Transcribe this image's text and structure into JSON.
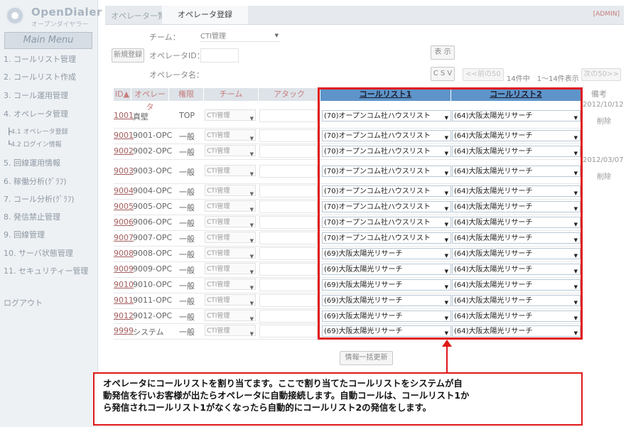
{
  "logo": {
    "name_en": "OpenDialer",
    "name_ja": "オープンダイヤラー"
  },
  "sidebar": {
    "main_menu": "Main Menu",
    "items": [
      "1. コールリスト管理",
      "2. コールリスト作成",
      "3. コール運用管理",
      "4. オペレータ管理",
      "┣4.1 オペレータ登録",
      "┗4.2 ログイン情報",
      "5. 回線運用情報",
      "6. 稼働分析(ｸﾞﾗﾌ)",
      "7. コール分析(ｸﾞﾗﾌ)",
      "8. 発信禁止管理",
      "9. 回線管理",
      "10. サーバ状態管理",
      "11. セキュリティー管理",
      "ログアウト"
    ]
  },
  "header": {
    "tab_list": "オペレータ一覧",
    "tab_register": "オペレータ登録",
    "admin": "[ADMIN]"
  },
  "form": {
    "team_label": "チーム：",
    "team_value": "CTI管理",
    "new_register_btn": "新規登録",
    "operator_id_label": "オペレータID：",
    "operator_name_label": "オペレータ名：",
    "show_btn": "表 示",
    "csv_btn": "C S V",
    "prev_btn": "<<前の50",
    "count": "14件中　1～14件表示",
    "next_btn": "次の50>>"
  },
  "table": {
    "columns": [
      "ID▲",
      "オペレータ",
      "権限",
      "チーム",
      "アタック",
      "コールリスト1",
      "コールリスト2",
      "備考"
    ],
    "rows": [
      {
        "id": "1001",
        "op": "真壁",
        "role": "TOP",
        "team": "CTI管理",
        "cl1": "(70)オープンコム社ハウスリスト",
        "cl2": "(64)大阪太陽光リサーチ",
        "date": "2012/10/12",
        "del": "削除"
      },
      {
        "id": "9001",
        "op": "9001-OPC",
        "role": "一般",
        "team": "CTI管理",
        "cl1": "(70)オープンコム社ハウスリスト",
        "cl2": "(64)大阪太陽光リサーチ",
        "date": "",
        "del": ""
      },
      {
        "id": "9002",
        "op": "9002-OPC",
        "role": "一般",
        "team": "CTI管理",
        "cl1": "(70)オープンコム社ハウスリスト",
        "cl2": "(64)大阪太陽光リサーチ",
        "date": "",
        "del": ""
      },
      {
        "id": "9003",
        "op": "9003-OPC",
        "role": "一般",
        "team": "CTI管理",
        "cl1": "(70)オープンコム社ハウスリスト",
        "cl2": "(64)大阪太陽光リサーチ",
        "date": "2012/03/07",
        "del": "削除"
      },
      {
        "id": "9004",
        "op": "9004-OPC",
        "role": "一般",
        "team": "CTI管理",
        "cl1": "(70)オープンコム社ハウスリスト",
        "cl2": "(64)大阪太陽光リサーチ",
        "date": "",
        "del": ""
      },
      {
        "id": "9005",
        "op": "9005-OPC",
        "role": "一般",
        "team": "CTI管理",
        "cl1": "(70)オープンコム社ハウスリスト",
        "cl2": "(64)大阪太陽光リサーチ",
        "date": "",
        "del": ""
      },
      {
        "id": "9006",
        "op": "9006-OPC",
        "role": "一般",
        "team": "CTI管理",
        "cl1": "(70)オープンコム社ハウスリスト",
        "cl2": "(64)大阪太陽光リサーチ",
        "date": "",
        "del": ""
      },
      {
        "id": "9007",
        "op": "9007-OPC",
        "role": "一般",
        "team": "CTI管理",
        "cl1": "(70)オープンコム社ハウスリスト",
        "cl2": "(64)大阪太陽光リサーチ",
        "date": "",
        "del": ""
      },
      {
        "id": "9008",
        "op": "9008-OPC",
        "role": "一般",
        "team": "CTI管理",
        "cl1": "(69)大阪太陽光リサーチ",
        "cl2": "(64)大阪太陽光リサーチ",
        "date": "",
        "del": ""
      },
      {
        "id": "9009",
        "op": "9009-OPC",
        "role": "一般",
        "team": "CTI管理",
        "cl1": "(69)大阪太陽光リサーチ",
        "cl2": "(64)大阪太陽光リサーチ",
        "date": "",
        "del": ""
      },
      {
        "id": "9010",
        "op": "9010-OPC",
        "role": "一般",
        "team": "CTI管理",
        "cl1": "(69)大阪太陽光リサーチ",
        "cl2": "(64)大阪太陽光リサーチ",
        "date": "",
        "del": ""
      },
      {
        "id": "9011",
        "op": "9011-OPC",
        "role": "一般",
        "team": "CTI管理",
        "cl1": "(69)大阪太陽光リサーチ",
        "cl2": "(64)大阪太陽光リサーチ",
        "date": "",
        "del": ""
      },
      {
        "id": "9012",
        "op": "9012-OPC",
        "role": "一般",
        "team": "CTI管理",
        "cl1": "(69)大阪太陽光リサーチ",
        "cl2": "(64)大阪太陽光リサーチ",
        "date": "",
        "del": ""
      },
      {
        "id": "9999",
        "op": "システム",
        "role": "一般",
        "team": "CTI管理",
        "cl1": "(69)大阪太陽光リサーチ",
        "cl2": "(64)大阪太陽光リサーチ",
        "date": "",
        "del": ""
      }
    ]
  },
  "bulk_update_btn": "情報一括更新",
  "callout": {
    "lines": [
      "オペレータにコールリストを割り当てます。ここで割り当てたコールリストをシステムが自",
      "動発信を行いお客様が出たらオペレータに自動接続します。自動コールは、コールリスト1か",
      "ら発信されコールリスト1がなくなったら自動的にコールリスト2の発信をします。"
    ]
  },
  "colors": {
    "highlight": "#e01818",
    "header_blue": "#5e94c9",
    "id_link": "#a45d5d"
  }
}
